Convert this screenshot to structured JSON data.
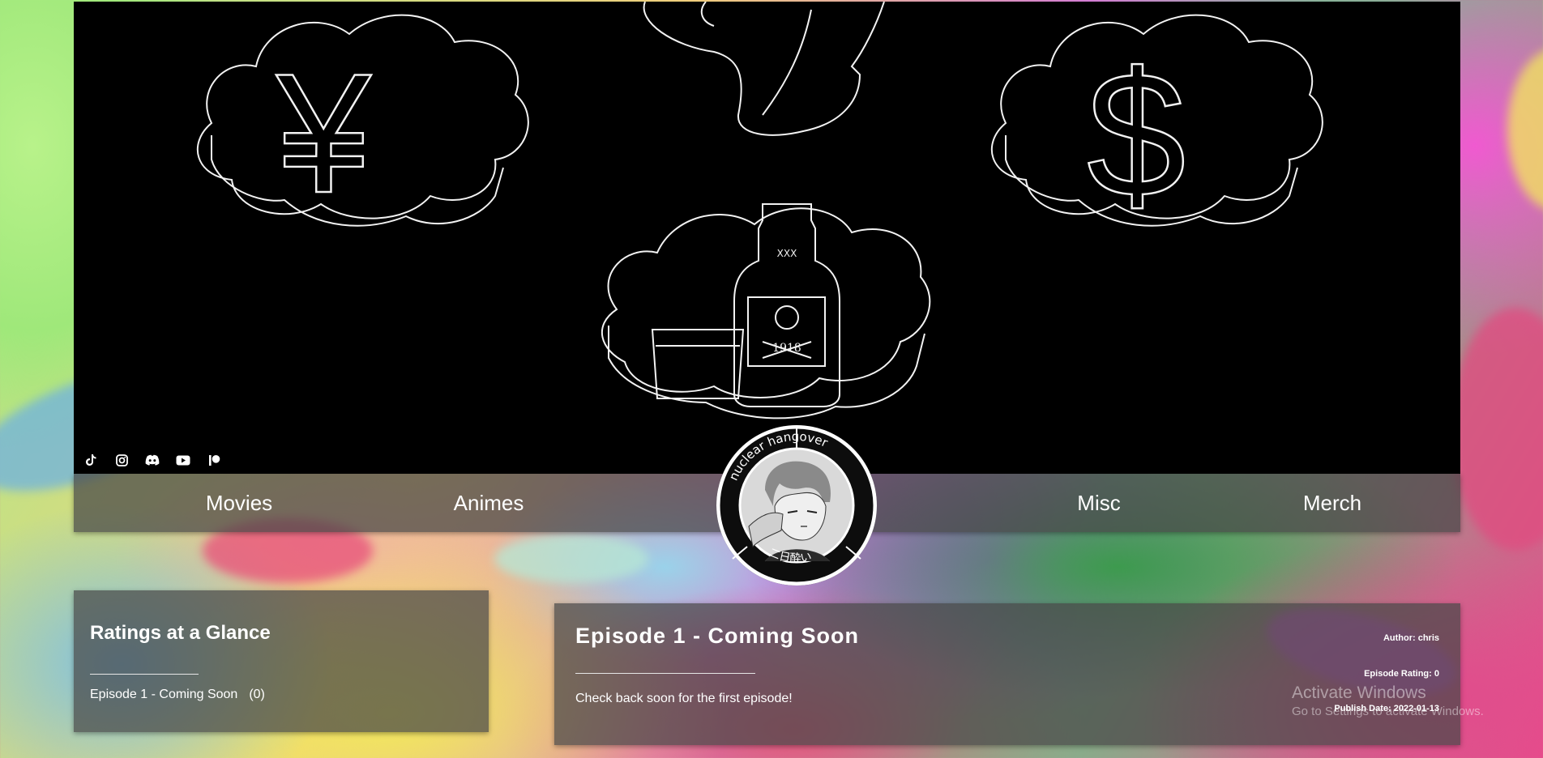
{
  "banner": {
    "bottle_label": "1918",
    "bottle_mark": "XXX"
  },
  "social_icons": [
    {
      "name": "tiktok-icon"
    },
    {
      "name": "instagram-icon"
    },
    {
      "name": "discord-icon"
    },
    {
      "name": "youtube-icon"
    },
    {
      "name": "patreon-icon"
    }
  ],
  "nav": {
    "items": [
      {
        "label": "Movies"
      },
      {
        "label": "Animes"
      },
      {
        "label": "Misc"
      },
      {
        "label": "Merch"
      }
    ]
  },
  "logo": {
    "ring_text": "nuclear hangover",
    "ring_text_jp": "二日酔い"
  },
  "ratings": {
    "title": "Ratings at a Glance",
    "entries": [
      {
        "episode": "Episode 1 - Coming Soon",
        "count": "(0)"
      }
    ]
  },
  "episode": {
    "title": "Episode 1 - Coming Soon",
    "body": "Check back soon for the first episode!",
    "author": "Author: chris",
    "rating": "Episode Rating: 0",
    "publish_date": "Publish Date: 2022-01-13"
  },
  "os_watermark": {
    "line1": "Activate Windows",
    "line2": "Go to Settings to activate Windows."
  }
}
